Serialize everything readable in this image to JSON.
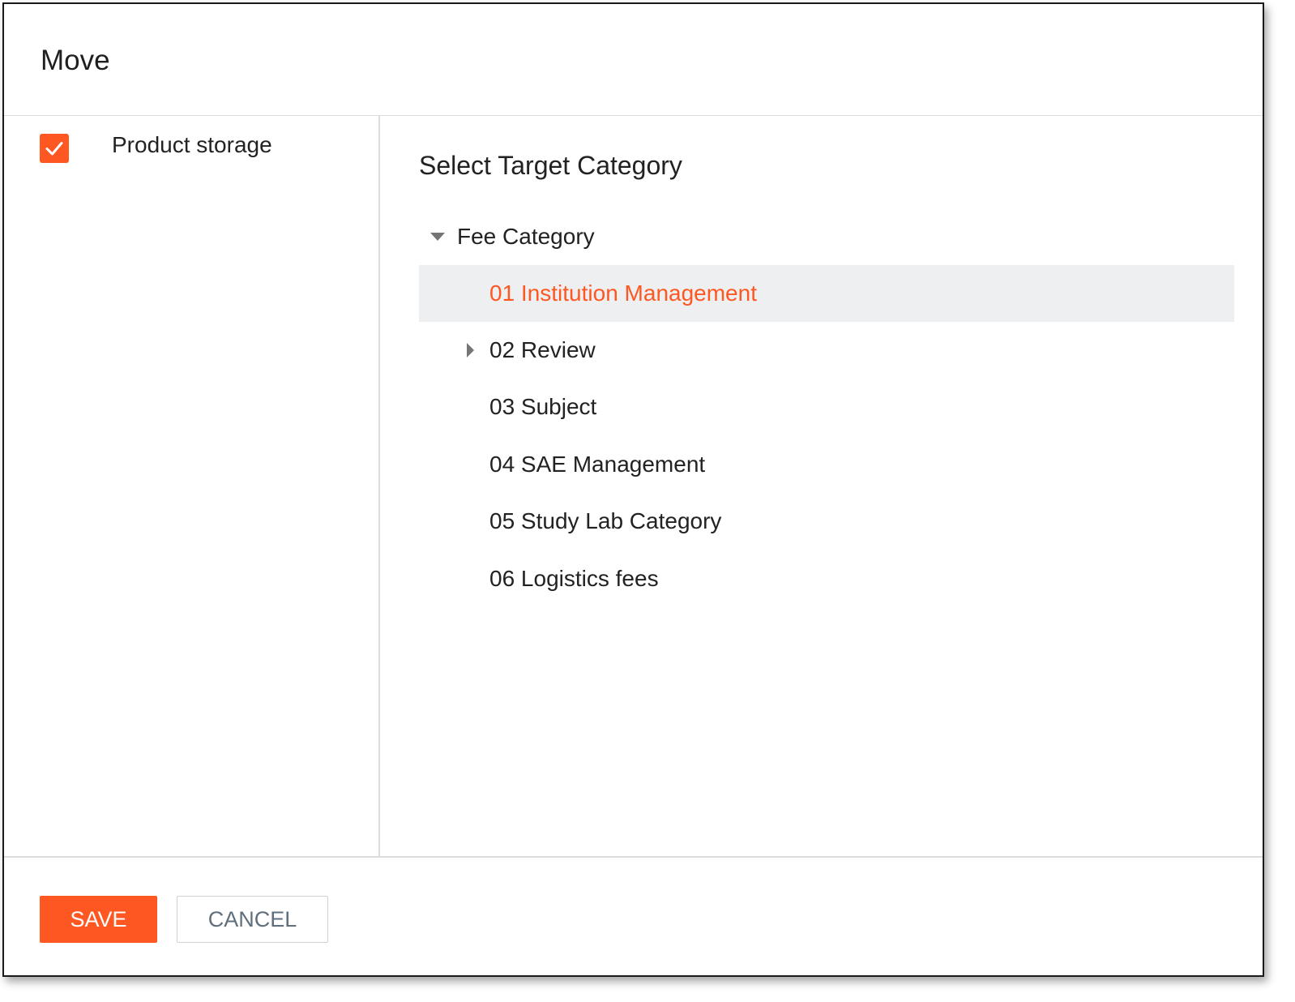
{
  "dialog": {
    "title": "Move"
  },
  "source": {
    "checked": true,
    "label": "Product storage"
  },
  "target": {
    "heading": "Select Target Category",
    "root": {
      "label": "Fee Category",
      "expanded": true
    },
    "children": [
      {
        "label": "01 Institution Management",
        "selected": true,
        "has_children": false
      },
      {
        "label": "02 Review",
        "selected": false,
        "has_children": true,
        "expanded": false
      },
      {
        "label": "03 Subject",
        "selected": false,
        "has_children": false
      },
      {
        "label": "04 SAE Management",
        "selected": false,
        "has_children": false
      },
      {
        "label": "05 Study Lab Category",
        "selected": false,
        "has_children": false
      },
      {
        "label": "06 Logistics fees",
        "selected": false,
        "has_children": false
      }
    ]
  },
  "footer": {
    "save_label": "SAVE",
    "cancel_label": "CANCEL"
  },
  "colors": {
    "accent": "#ff5722",
    "selected_bg": "#eeeff1",
    "text": "#222222"
  },
  "icons": {
    "checkbox": "check-icon",
    "expanded": "caret-down-icon",
    "collapsed": "caret-right-icon"
  }
}
